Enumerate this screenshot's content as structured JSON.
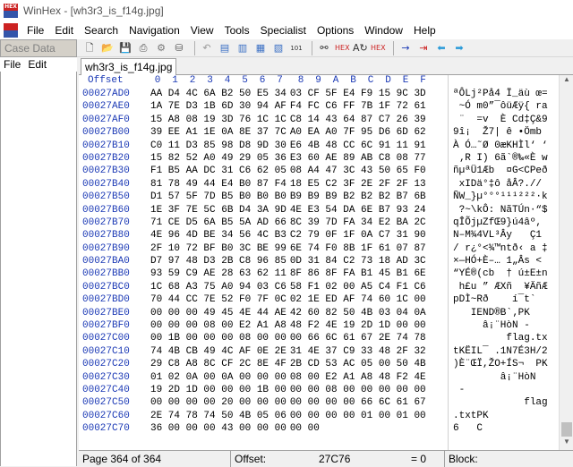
{
  "window": {
    "title": "WinHex - [wh3r3_is_f14g.jpg]",
    "app_icon_text": "HEX"
  },
  "menu": [
    "File",
    "Edit",
    "Search",
    "Navigation",
    "View",
    "Tools",
    "Specialist",
    "Options",
    "Window",
    "Help"
  ],
  "left_panel": {
    "header": "Case Data",
    "menu": [
      "File",
      "Edit"
    ]
  },
  "tab": {
    "label": "wh3r3_is_f14g.jpg"
  },
  "toolbar_icons": [
    "new-file",
    "open",
    "save",
    "print",
    "properties",
    "undo",
    "copy",
    "paste",
    "paste-special",
    "write",
    "find-text",
    "find-hex",
    "replace-text",
    "replace-hex",
    "go-to",
    "back",
    "forward"
  ],
  "editor": {
    "offset_header": "Offset",
    "columns": [
      "0",
      "1",
      "2",
      "3",
      "4",
      "5",
      "6",
      "7",
      "8",
      "9",
      "A",
      "B",
      "C",
      "D",
      "E",
      "F"
    ],
    "rows": [
      {
        "offset": "00027AD0",
        "hex1": "AA D4 4C 6A B2 50 E5 34",
        "hex2": "03 CF 5F E4 F9 15 9C 3D",
        "ascii": "ªÔLj²På4 Ï_äù œ="
      },
      {
        "offset": "00027AE0",
        "hex1": "1A 7E D3 1B 6D 30 94 AF",
        "hex2": "F4 FC C6 FF 7B 1F 72 61",
        "ascii": " ~Ó m0”¯ôüÆÿ{ ra"
      },
      {
        "offset": "00027AF0",
        "hex1": "15 A8 08 19 3D 76 1C 1C",
        "hex2": "C8 14 43 64 87 C7 26 39",
        "ascii": " ¨  =v  È Cd‡Ç&9"
      },
      {
        "offset": "00027B00",
        "hex1": "39 EE A1 1E 0A 8E 37 7C",
        "hex2": "A0 EA A0 7F 95 D6 6D 62",
        "ascii": "9î¡  Ž7| ê •Ömb"
      },
      {
        "offset": "00027B10",
        "hex1": "C0 11 D3 85 98 D8 9D 30",
        "hex2": "E6 4B 48 CC 6C 91 11 91",
        "ascii": "À Ó…˜Ø 0æKHÌl‘ ‘"
      },
      {
        "offset": "00027B20",
        "hex1": "15 82 52 A0 49 29 05 36",
        "hex2": "E3 60 AE 89 AB C8 08 77",
        "ascii": " ‚R I) 6ã`®‰«È w"
      },
      {
        "offset": "00027B30",
        "hex1": "F1 B5 AA DC 31 C6 62 05",
        "hex2": "08 A4 47 3C 43 50 65 F0",
        "ascii": "ñµªÜ1Æb  ¤G<CPeð"
      },
      {
        "offset": "00027B40",
        "hex1": "81 78 49 44 E4 B0 87 F4",
        "hex2": "18 E5 C2 3F 2E 2F 2F 13",
        "ascii": " xIDä°‡ô åÂ?.// "
      },
      {
        "offset": "00027B50",
        "hex1": "D1 57 5F 7D B5 B0 B0 B0",
        "hex2": "B9 B9 B9 B2 B2 B2 B7 6B",
        "ascii": "ÑW_}µ°°°¹¹¹²²²·k"
      },
      {
        "offset": "00027B60",
        "hex1": "1E 3F 7E 5C 6B D4 3A 9D",
        "hex2": "4E E3 54 DA 6E B7 93 24",
        "ascii": " ?~\\kÔ: NãTÚn·“$"
      },
      {
        "offset": "00027B70",
        "hex1": "71 CE D5 6A B5 5A AD 66",
        "hex2": "8C 39 7D FA 34 E2 BA 2C",
        "ascii": "qÎÕjµZ­fŒ9}ú4âº,"
      },
      {
        "offset": "00027B80",
        "hex1": "4E 96 4D BE 34 56 4C B3",
        "hex2": "C2 79 0F 1F 0A C7 31 90",
        "ascii": "N–M¾4VL³Ây   Ç1 "
      },
      {
        "offset": "00027B90",
        "hex1": "2F 10 72 BF B0 3C BE 99",
        "hex2": "6E 74 F0 8B 1F 61 07 87",
        "ascii": "/ r¿°<¾™ntð‹ a ‡"
      },
      {
        "offset": "00027BA0",
        "hex1": "D7 97 48 D3 2B C8 96 85",
        "hex2": "0D 31 84 C2 73 18 AD 3C",
        "ascii": "×—HÓ+È–… 1„Âs ­<"
      },
      {
        "offset": "00027BB0",
        "hex1": "93 59 C9 AE 28 63 62 11",
        "hex2": "8F 86 8F FA B1 45 B1 6E",
        "ascii": "“YÉ®(cb  † ú±E±n"
      },
      {
        "offset": "00027BC0",
        "hex1": "1C 68 A3 75 A0 94 03 C6",
        "hex2": "58 F1 02 00 A5 C4 F1 C6",
        "ascii": " h£u ” ÆXñ  ¥ÄñÆ"
      },
      {
        "offset": "00027BD0",
        "hex1": "70 44 CC 7E 52 F0 7F 0C",
        "hex2": "02 1E ED AF 74 60 1C 00",
        "ascii": "pDÌ~Rð    í¯t`  "
      },
      {
        "offset": "00027BE0",
        "hex1": "00 00 00 49 45 4E 44 AE",
        "hex2": "42 60 82 50 4B 03 04 0A",
        "ascii": "   IEND®B`‚PK   "
      },
      {
        "offset": "00027BF0",
        "hex1": "00 00 00 08 00 E2 A1 A8",
        "hex2": "48 F2 4E 19 2D 1D 00 00",
        "ascii": "     â¡¨HòN -   "
      },
      {
        "offset": "00027C00",
        "hex1": "00 1B 00 00 00 08 00 00",
        "hex2": "00 66 6C 61 67 2E 74 78",
        "ascii": "         flag.tx"
      },
      {
        "offset": "00027C10",
        "hex1": "74 4B CB 49 4C AF 0E 2E",
        "hex2": "31 4E 37 C9 33 48 2F 32",
        "ascii": "tKËIL¯ .1N7É3H/2"
      },
      {
        "offset": "00027C20",
        "hex1": "29 C8 A8 8C CF 2C 8E 4F",
        "hex2": "2B CD 53 AC 05 00 50 4B",
        "ascii": ")È¨ŒÏ,ŽO+ÍS¬  PK"
      },
      {
        "offset": "00027C30",
        "hex1": "01 02 0A 00 0A 00 00 00",
        "hex2": "08 00 E2 A1 A8 48 F2 4E",
        "ascii": "        â¡¨HòN"
      },
      {
        "offset": "00027C40",
        "hex1": "19 2D 1D 00 00 00 1B 00",
        "hex2": "00 00 08 00 00 00 00 00",
        "ascii": " -              "
      },
      {
        "offset": "00027C50",
        "hex1": "00 00 00 00 20 00 00 00",
        "hex2": "00 00 00 00 66 6C 61 67",
        "ascii": "            flag"
      },
      {
        "offset": "00027C60",
        "hex1": "2E 74 78 74 50 4B 05 06",
        "hex2": "00 00 00 00 01 00 01 00",
        "ascii": ".txtPK          "
      },
      {
        "offset": "00027C70",
        "hex1": "36 00 00 00 43 00 00 00",
        "hex2": "00 00",
        "ascii": "6   C     "
      }
    ]
  },
  "status": {
    "page": "Page 364 of 364",
    "offset_label": "Offset:",
    "offset_value": "27C76",
    "equals": "= 0",
    "block_label": "Block:"
  }
}
